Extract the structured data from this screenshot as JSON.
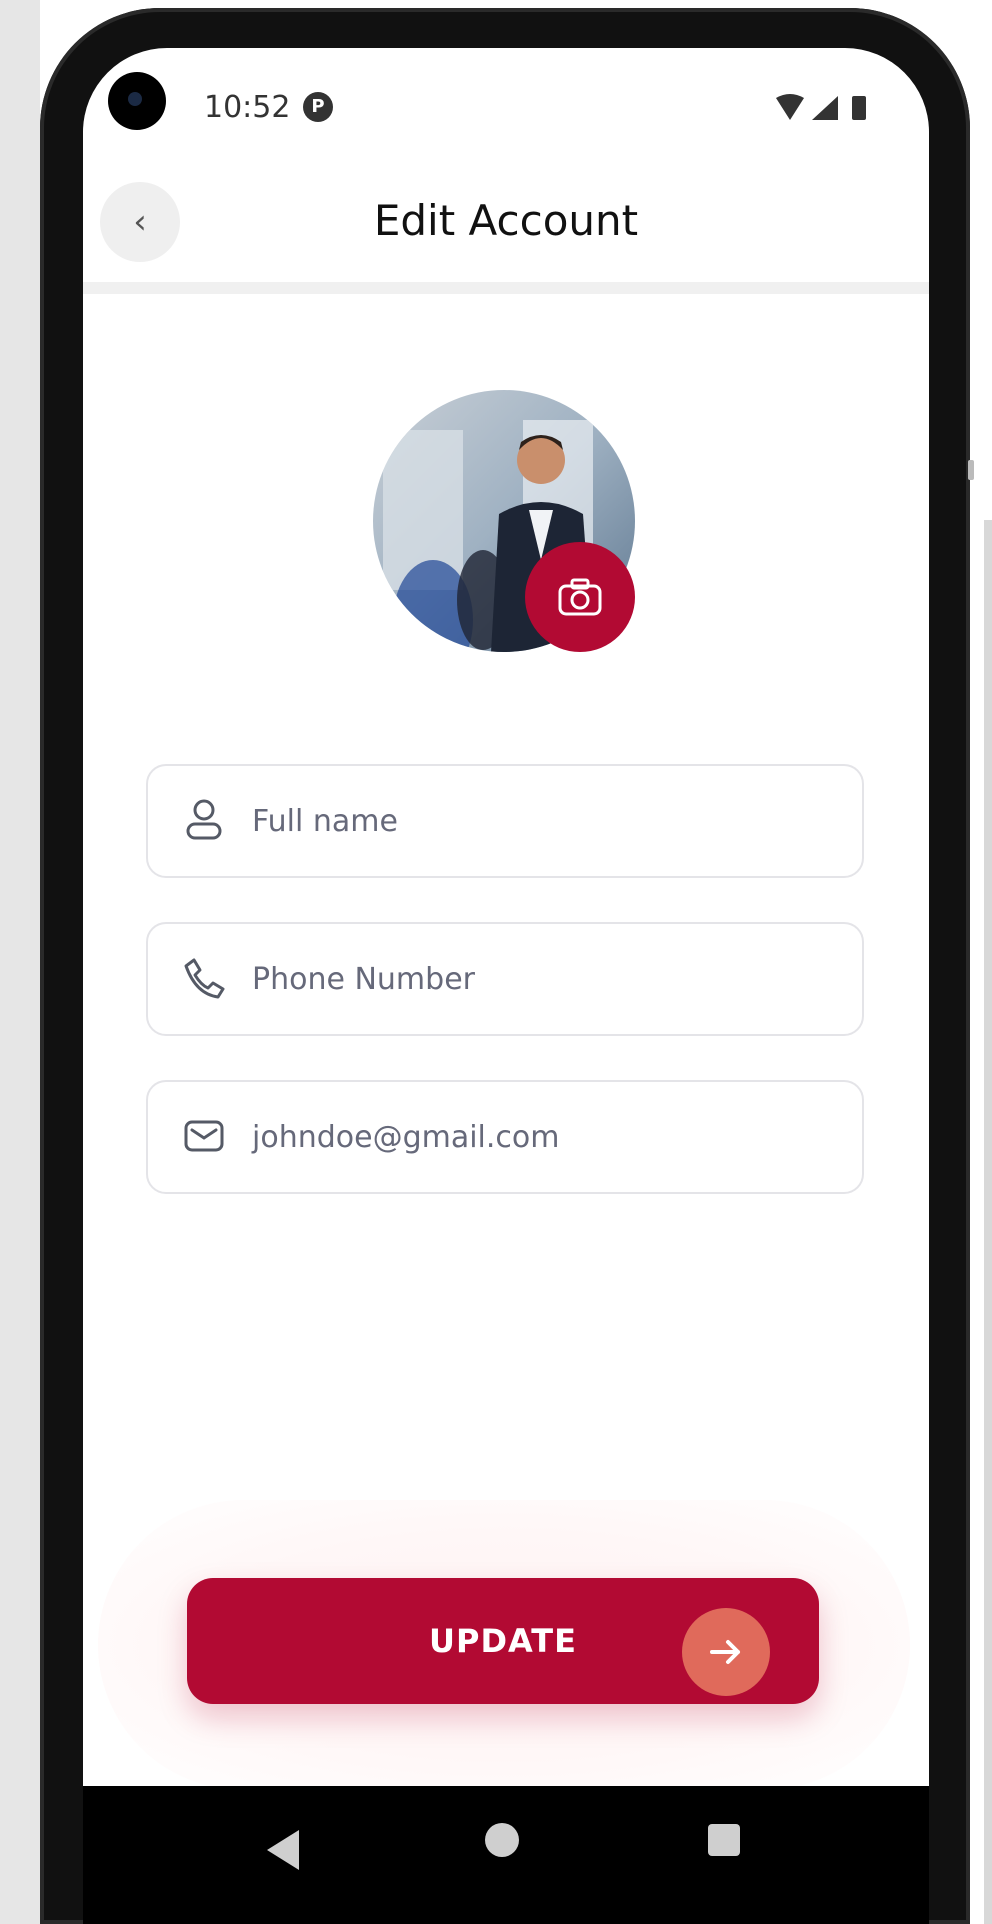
{
  "status_bar": {
    "time": "10:52",
    "notification_icon_glyph": "P"
  },
  "header": {
    "back_glyph": "‹",
    "title": "Edit Account"
  },
  "profile": {
    "camera_icon": "camera-icon"
  },
  "form": {
    "fields": [
      {
        "name": "full-name-field",
        "icon": "user-icon",
        "value": "Full name"
      },
      {
        "name": "phone-number-field",
        "icon": "phone-icon",
        "value": "Phone Number"
      },
      {
        "name": "email-field",
        "icon": "mail-icon",
        "value": "johndoe@gmail.com"
      }
    ]
  },
  "action": {
    "update_label": "UPDATE",
    "arrow_icon": "arrow-right-icon"
  },
  "colors": {
    "accent": "#b20a33",
    "arrow_circle": "#e06a5b"
  }
}
